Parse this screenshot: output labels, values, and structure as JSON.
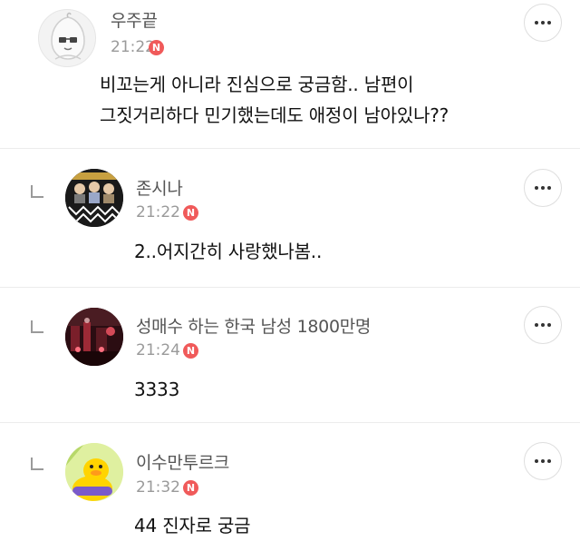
{
  "comments": [
    {
      "author": "우주끝",
      "time": "21:22",
      "badge": "N",
      "lines": [
        "비꼬는게 아니라 진심으로 궁금함.. 남편이",
        "그짓거리하다 민기했는데도 애정이 남아있나??"
      ],
      "is_reply": false,
      "avatar_icon": "peach-character-avatar-icon"
    },
    {
      "author": "존시나",
      "time": "21:22",
      "badge": "N",
      "lines": [
        "2..어지간히 사랑했나봄.."
      ],
      "is_reply": true,
      "avatar_icon": "group-photo-avatar-icon"
    },
    {
      "author": "성매수 하는 한국 남성 1800만명",
      "time": "21:24",
      "badge": "N",
      "lines": [
        "3333"
      ],
      "is_reply": true,
      "avatar_icon": "night-street-avatar-icon"
    },
    {
      "author": "이수만투르크",
      "time": "21:32",
      "badge": "N",
      "lines": [
        "44 진자로 궁금"
      ],
      "is_reply": true,
      "avatar_icon": "yellow-duck-avatar-icon"
    }
  ],
  "colors": {
    "badge": "#f05a5a",
    "name": "#555555",
    "time": "#9a9a9a",
    "separator": "#ececec"
  }
}
